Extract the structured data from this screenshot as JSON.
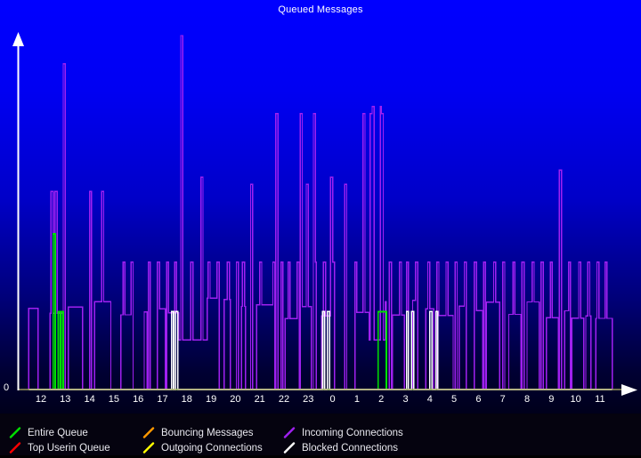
{
  "chart_data": {
    "type": "line",
    "title": "Queued Messages",
    "xlabel": "",
    "ylabel": "",
    "grid": false,
    "legend_position": "below",
    "ylim": [
      0,
      100
    ],
    "y_tick_labels": [
      "0"
    ],
    "x_tick_labels": [
      "12",
      "13",
      "14",
      "15",
      "16",
      "17",
      "18",
      "19",
      "20",
      "21",
      "22",
      "23",
      "0",
      "1",
      "2",
      "3",
      "4",
      "5",
      "6",
      "7",
      "8",
      "9",
      "10",
      "11"
    ],
    "x_axis_kind": "hour-of-day",
    "series": [
      {
        "name": "Entire Queue",
        "color": "#00e000",
        "values": [
          0,
          0,
          0,
          0,
          0,
          0,
          0,
          0,
          0,
          0,
          0,
          0,
          0,
          0,
          0,
          0,
          0,
          0,
          0,
          0,
          0,
          0,
          0,
          0,
          0,
          0,
          0,
          0,
          0,
          0,
          0,
          0,
          0,
          0,
          0,
          0,
          0,
          0,
          0,
          0,
          0,
          0,
          0,
          0,
          0,
          0,
          0,
          0,
          0,
          0,
          0,
          0,
          0,
          0,
          0,
          0,
          0,
          0,
          0,
          0,
          0,
          0,
          0,
          0,
          0,
          0,
          0,
          0,
          0,
          0,
          0,
          0,
          0,
          0,
          0,
          0,
          0,
          0,
          0,
          0,
          0,
          0,
          0,
          0,
          0,
          0,
          0,
          0,
          0,
          0,
          44,
          44,
          0,
          0,
          13,
          13,
          13,
          0,
          0,
          0,
          0,
          0,
          0,
          0,
          0,
          0,
          0,
          0,
          0,
          0,
          0,
          0,
          0,
          0,
          0,
          0,
          0,
          0,
          0,
          0,
          0,
          0,
          0,
          0,
          0,
          0,
          0,
          0,
          0,
          0,
          0,
          0,
          0,
          0,
          0,
          0,
          0,
          0,
          0,
          0,
          0,
          0,
          0,
          0,
          0,
          0,
          0,
          0,
          0,
          0,
          0,
          0,
          0,
          0,
          0,
          0,
          0,
          0,
          0,
          0,
          0,
          0,
          0,
          0,
          0,
          0,
          0,
          0,
          0,
          0,
          0,
          0,
          0,
          0,
          0,
          0,
          0,
          0,
          0,
          0,
          0,
          0,
          0,
          0,
          0,
          0,
          0,
          0,
          0,
          0,
          0,
          0,
          0,
          0,
          0,
          0,
          0,
          0,
          0,
          0,
          0,
          0,
          0,
          0,
          0,
          0,
          0,
          0,
          0,
          0,
          0,
          0,
          0,
          0,
          0,
          0,
          0,
          0,
          0,
          0,
          0,
          0,
          0,
          0,
          0,
          0,
          0,
          0,
          0,
          0,
          0,
          0,
          0,
          0,
          0,
          0,
          0,
          0,
          0,
          0,
          0,
          0,
          0,
          0,
          0,
          0,
          0,
          0,
          0,
          0,
          0,
          0,
          0,
          0,
          0,
          0,
          0,
          0,
          0,
          0,
          0,
          0,
          0,
          0,
          0,
          0,
          0,
          0,
          0,
          0,
          0,
          0,
          0,
          0,
          0,
          0,
          0,
          0,
          0,
          0,
          0,
          0,
          0,
          0,
          0,
          0,
          0,
          0,
          0,
          0,
          0,
          0,
          0,
          0,
          0,
          0,
          0,
          0,
          0,
          0,
          0,
          0,
          0,
          0,
          0,
          0,
          0,
          0,
          0,
          0,
          0,
          0,
          0,
          0,
          0,
          0,
          0,
          0,
          0,
          0,
          0,
          0,
          0,
          0,
          0,
          0,
          0,
          0,
          0,
          0,
          0,
          0,
          0,
          0,
          0,
          0,
          0,
          0,
          0,
          0,
          0,
          0,
          0,
          0,
          0,
          0,
          0,
          0,
          0,
          0,
          0,
          0,
          0,
          0,
          0,
          0,
          0,
          0,
          0,
          0,
          0,
          0,
          0,
          0,
          0,
          0,
          0,
          0,
          0,
          0,
          0,
          0,
          0,
          0,
          0,
          0,
          0,
          0,
          0,
          0,
          0,
          0,
          0,
          0,
          0,
          0,
          0,
          0,
          0,
          0,
          0,
          0,
          0,
          0,
          0,
          0,
          0,
          0,
          0,
          0,
          0,
          0,
          0,
          0,
          0,
          0,
          0,
          0,
          0,
          0,
          0,
          0,
          0,
          0,
          0,
          0,
          0,
          0,
          0,
          0,
          0,
          0,
          0,
          0,
          0,
          0,
          0,
          0,
          0,
          0,
          0,
          0,
          0,
          0,
          0,
          0,
          0,
          0,
          0,
          0,
          0,
          0,
          0,
          0,
          0,
          0,
          0,
          0,
          0,
          0,
          0,
          0,
          0,
          0,
          0,
          0,
          0,
          0,
          0,
          0,
          0,
          0,
          0,
          0,
          0,
          0,
          0,
          0,
          0,
          0,
          0,
          0,
          0,
          0,
          0,
          0,
          0,
          0,
          0,
          0,
          0,
          0,
          0,
          0,
          0,
          0,
          0,
          0,
          0,
          0,
          0,
          0,
          0,
          0,
          0,
          0,
          0,
          0,
          0,
          0,
          0,
          0,
          0,
          0,
          0,
          0,
          0,
          0,
          0,
          0,
          0,
          0,
          0,
          0,
          0,
          0,
          0,
          0,
          0,
          0,
          0,
          0,
          0,
          0,
          0,
          0,
          0,
          0,
          0,
          0,
          0,
          0,
          0,
          0,
          0,
          0,
          0,
          0,
          0,
          0,
          0,
          0,
          0,
          0,
          0,
          0,
          0,
          0,
          0,
          0,
          0,
          0,
          0,
          0,
          0,
          0,
          0,
          0,
          0,
          0,
          0,
          0,
          0,
          0,
          0,
          0,
          0,
          0,
          0,
          0,
          0,
          0,
          0,
          0,
          0,
          0,
          0,
          0,
          0,
          0,
          0,
          0,
          0,
          0,
          0,
          0,
          0,
          0,
          0,
          0,
          0,
          0,
          0,
          0,
          0,
          0,
          0,
          0,
          0,
          0,
          0,
          0,
          0,
          0,
          0,
          0,
          0,
          0,
          0,
          0,
          0,
          0,
          0,
          0,
          0,
          0,
          0,
          0,
          0,
          0,
          0,
          0,
          0,
          0,
          0,
          0,
          0,
          0,
          0,
          0,
          0,
          0,
          0,
          0,
          0,
          0,
          0,
          0,
          0,
          0,
          0,
          0,
          0,
          0,
          0,
          0,
          0,
          0,
          0,
          0,
          0,
          0,
          0,
          0,
          0,
          0,
          0,
          0,
          0,
          0,
          0,
          0,
          0,
          0,
          0,
          0,
          0,
          0,
          0,
          0,
          0,
          0,
          0,
          0,
          0,
          0,
          0,
          0,
          0,
          0,
          0,
          0,
          0,
          0,
          0,
          0,
          0,
          0,
          0,
          0,
          0,
          0,
          0,
          0,
          0,
          0,
          0,
          0,
          0,
          0,
          0,
          0,
          0,
          0,
          0,
          0,
          0,
          0,
          0,
          0
        ]
      },
      {
        "name": "Top Userin Queue",
        "color": "#ff0000",
        "values": []
      },
      {
        "name": "Bouncing Messages",
        "color": "#ff9900",
        "values": []
      },
      {
        "name": "Outgoing Connections",
        "color": "#ffff00",
        "values": []
      },
      {
        "name": "Incoming Connections",
        "color": "#a020f0",
        "values": []
      },
      {
        "name": "Blocked Connections",
        "color": "#ffffff",
        "values": []
      }
    ],
    "notes": "Step-line (MRTG-style) traffic plot. Purple 'Incoming Connections' is the dominant series with frequent spikes; green 'Entire Queue' spikes appear near hour 12 and hour 3; white 'Blocked Connections' spikes appear near hours 17, 23, 4 and 5. Tallest purple spike occurs near hour 18."
  },
  "header": {
    "title": "Queued Messages"
  },
  "axes": {
    "y_zero": "0",
    "x_ticks": [
      {
        "label": "12"
      },
      {
        "label": "13"
      },
      {
        "label": "14"
      },
      {
        "label": "15"
      },
      {
        "label": "16"
      },
      {
        "label": "17"
      },
      {
        "label": "18"
      },
      {
        "label": "19"
      },
      {
        "label": "20"
      },
      {
        "label": "21"
      },
      {
        "label": "22"
      },
      {
        "label": "23"
      },
      {
        "label": "0"
      },
      {
        "label": "1"
      },
      {
        "label": "2"
      },
      {
        "label": "3"
      },
      {
        "label": "4"
      },
      {
        "label": "5"
      },
      {
        "label": "6"
      },
      {
        "label": "7"
      },
      {
        "label": "8"
      },
      {
        "label": "9"
      },
      {
        "label": "10"
      },
      {
        "label": "11"
      }
    ]
  },
  "legend": {
    "items": [
      {
        "label": "Entire Queue",
        "color": "#00e000",
        "col": 0,
        "row": 0
      },
      {
        "label": "Top Userin Queue",
        "color": "#ff0000",
        "col": 0,
        "row": 1
      },
      {
        "label": "Bouncing Messages",
        "color": "#ff9900",
        "col": 1,
        "row": 0
      },
      {
        "label": "Outgoing Connections",
        "color": "#ffff00",
        "col": 1,
        "row": 1
      },
      {
        "label": "Incoming Connections",
        "color": "#a020f0",
        "col": 2,
        "row": 0
      },
      {
        "label": "Blocked Connections",
        "color": "#ffffff",
        "col": 2,
        "row": 1
      }
    ]
  },
  "colors": {
    "background_top": "#0000ff",
    "background_bottom": "#00001b",
    "axis": "#ffffff",
    "baseline": "#9a9a5a",
    "legend_background": "#05030f",
    "text": "#ffffff"
  },
  "geometry": {
    "plot_left": 20,
    "plot_right": 700,
    "baseline_y": 438,
    "top_y": 40,
    "first_tick_x": 46,
    "tick_spacing": 27.3
  }
}
